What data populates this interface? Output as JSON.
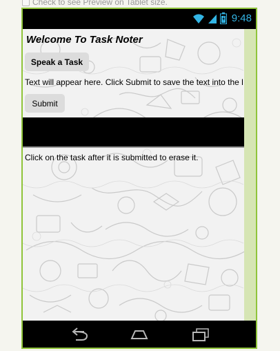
{
  "preview": {
    "checkbox_label": "Check to see Preview on Tablet size."
  },
  "status_bar": {
    "time": "9:48",
    "icons": [
      "wifi-icon",
      "signal-icon",
      "battery-icon"
    ]
  },
  "app": {
    "title": "Welcome To Task Noter",
    "speak_button": "Speak a Task",
    "info_text": "Text will appear here. Click Submit to save the text into the l",
    "submit_button": "Submit",
    "hint_text": "Click on the task after it is submitted to erase it."
  },
  "nav_bar": {
    "buttons": [
      "back-icon",
      "home-icon",
      "recent-apps-icon"
    ]
  },
  "colors": {
    "device_border": "#8fc43a",
    "status_accent": "#33b5e5",
    "button_bg": "#dcdcdc"
  }
}
